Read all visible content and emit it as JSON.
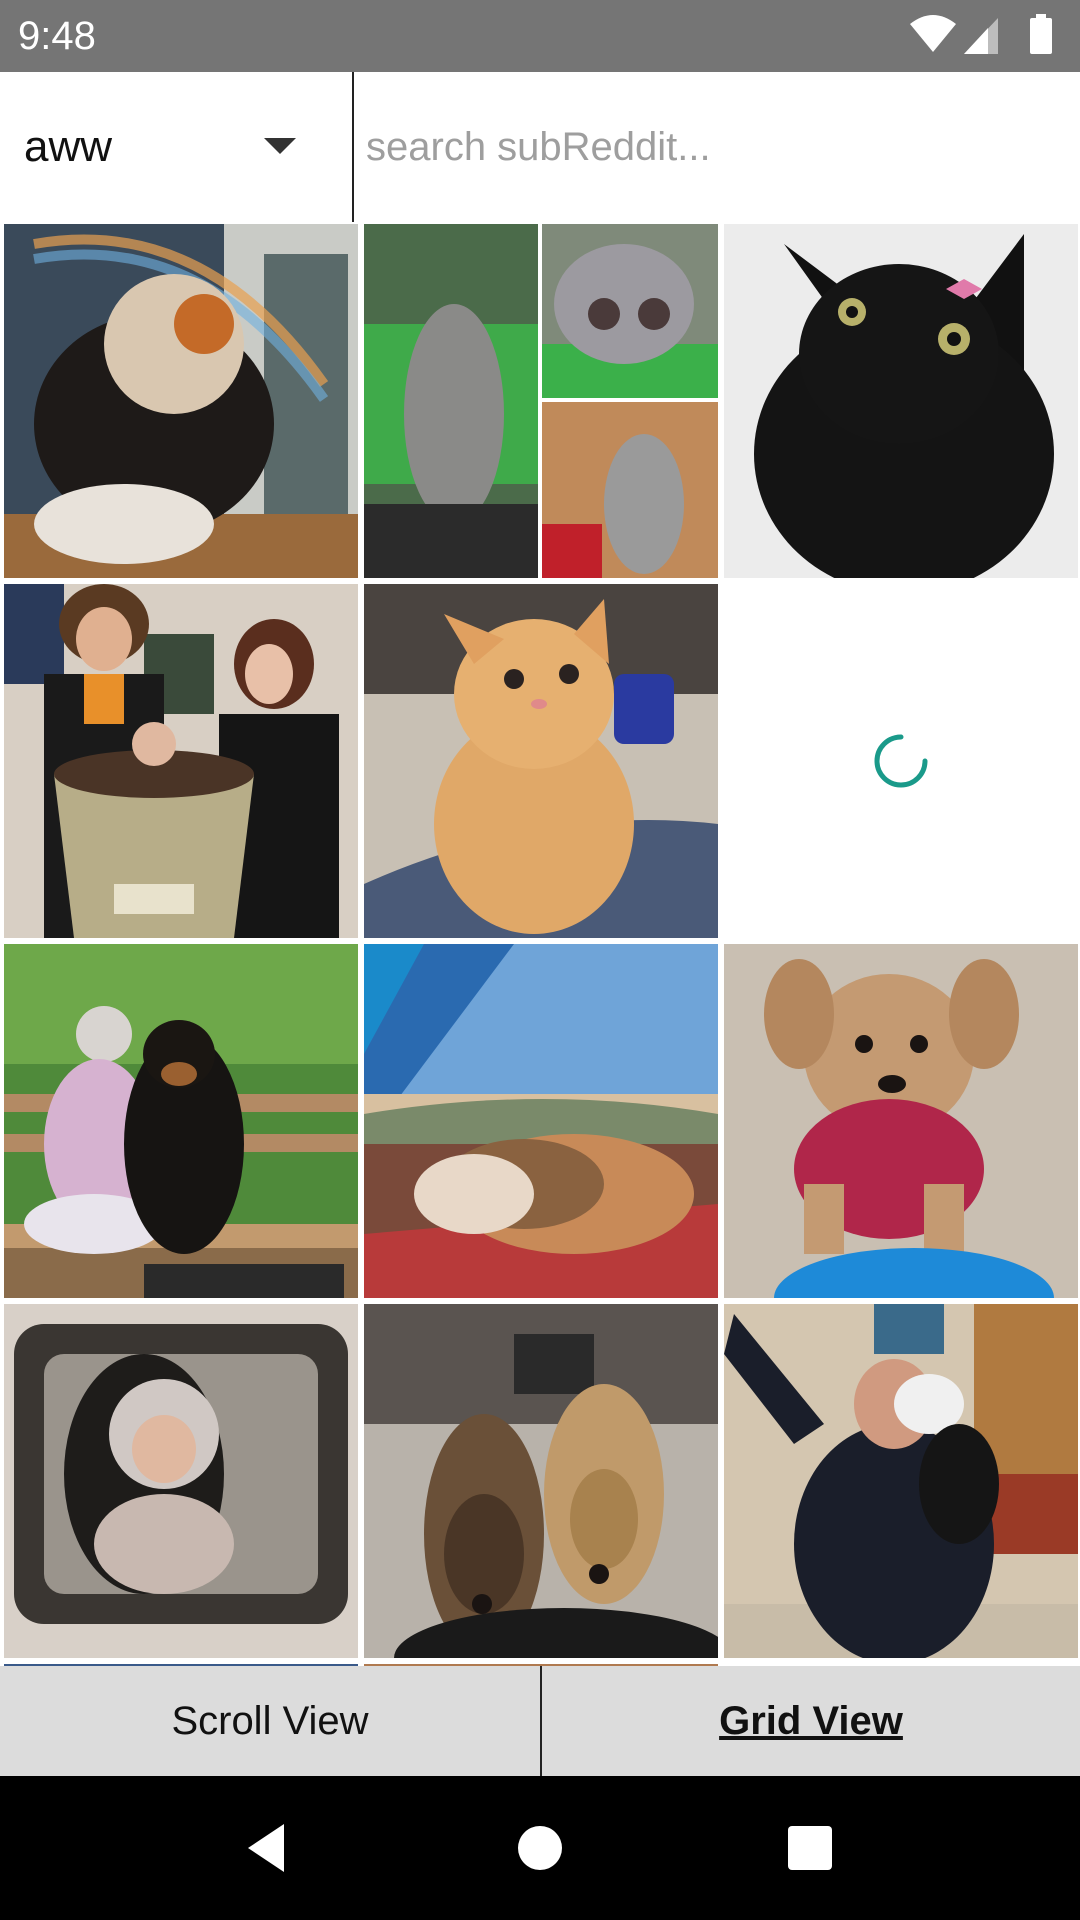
{
  "status_bar": {
    "time": "9:48",
    "icons": [
      "wifi-icon",
      "cell-signal-icon",
      "battery-icon"
    ]
  },
  "header": {
    "subreddit": "aww",
    "search_placeholder": "search subReddit..."
  },
  "grid": {
    "columns": 3,
    "tiles": [
      {
        "name": "calico-cat-window",
        "icon": "photo"
      },
      {
        "name": "manul-cat-collage",
        "icon": "photo"
      },
      {
        "name": "black-cat-bow",
        "icon": "photo"
      },
      {
        "name": "family-mandrake-baby",
        "icon": "photo"
      },
      {
        "name": "orange-kitten",
        "icon": "photo"
      },
      {
        "name": "loading-tile",
        "icon": "spinner"
      },
      {
        "name": "woman-rottweiler",
        "icon": "photo"
      },
      {
        "name": "dog-cat-tent",
        "icon": "photo"
      },
      {
        "name": "puppy-red-harness",
        "icon": "photo"
      },
      {
        "name": "baby-car-mirror",
        "icon": "photo"
      },
      {
        "name": "two-greyhounds",
        "icon": "photo"
      },
      {
        "name": "officer-with-cat",
        "icon": "photo"
      }
    ]
  },
  "view_toggle": {
    "scroll_label": "Scroll View",
    "grid_label": "Grid View",
    "active": "grid"
  },
  "nav_bar": {
    "icons": [
      "back-icon",
      "home-icon",
      "recents-icon"
    ]
  },
  "colors": {
    "status_bar": "#757575",
    "toggle_bg": "#dcdcdc",
    "spinner": "#1a9a8a",
    "nav_bg": "#000000"
  }
}
